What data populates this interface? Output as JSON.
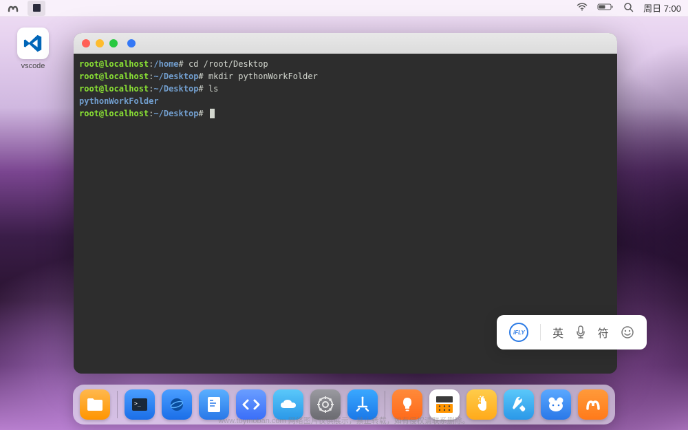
{
  "menubar": {
    "time_label": "周日 7:00"
  },
  "desktop": {
    "vscode_label": "vscode"
  },
  "terminal": {
    "lines": [
      {
        "user": "root@localhost",
        "sep": ":",
        "path": "/home",
        "prompt": "#",
        "cmd": " cd /root/Desktop"
      },
      {
        "user": "root@localhost",
        "sep": ":",
        "path": "~/Desktop",
        "prompt": "#",
        "cmd": " mkdir pythonWorkFolder"
      },
      {
        "user": "root@localhost",
        "sep": ":",
        "path": "~/Desktop",
        "prompt": "#",
        "cmd": " ls"
      },
      {
        "output": "pythonWorkFolder"
      },
      {
        "user": "root@localhost",
        "sep": ":",
        "path": "~/Desktop",
        "prompt": "#",
        "cmd": " ",
        "cursor": true
      }
    ]
  },
  "ime": {
    "logo": "iFLY",
    "lang": "英",
    "sym": "符"
  },
  "watermark": "www.toymoban.com  网络图片仅供展示，禁止转载，如有侵权请联系删除。"
}
